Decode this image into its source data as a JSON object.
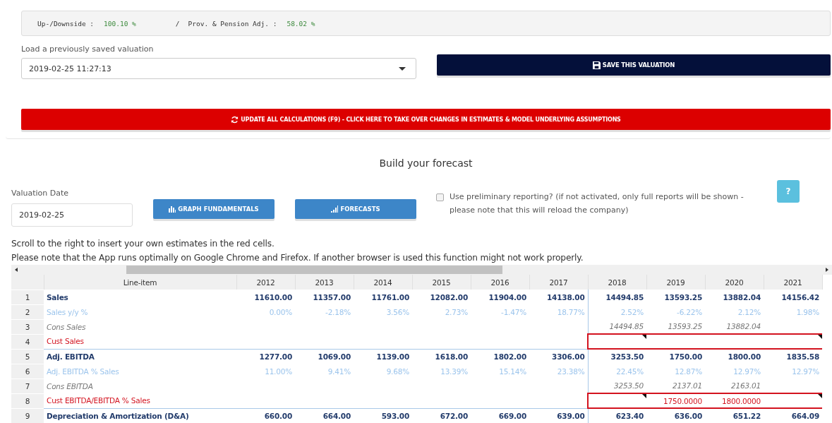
{
  "summary": {
    "items": [
      {
        "label": "Up-/Downside :",
        "value": "100.10 %"
      },
      {
        "label": "Prov. & Pension Adj. :",
        "value": "58.02 %"
      }
    ],
    "separator": "/"
  },
  "load": {
    "label": "Load a previously saved valuation",
    "value": "2019-02-25 11:27:13"
  },
  "save_button": "SAVE THIS VALUATION",
  "update_button": "UPDATE ALL CALCULATIONS (F9) - CLICK HERE TO TAKE OVER CHANGES IN ESTIMATES & MODEL UNDERLYING ASSUMPTIONS",
  "section_title": "Build your forecast",
  "valuation_date": {
    "label": "Valuation Date",
    "value": "2019-02-25"
  },
  "graph_button": "GRAPH FUNDAMENTALS",
  "forecasts_button": "FORECASTS",
  "preliminary": {
    "label": "Use preliminary reporting? (if not activated, only full reports will be shown - please note that this will reload the company)",
    "checked": false
  },
  "help_button": "?",
  "notes": [
    "Scroll to the right to insert your own estimates in the red cells.",
    "Please note that the App runs optimally on Google Chrome and Firefox. If another browser is used this function might not work properly."
  ],
  "table": {
    "columns": [
      {
        "kind": "number"
      },
      {
        "kind": "item",
        "label": "Line-item"
      },
      {
        "kind": "actual",
        "label": "2012"
      },
      {
        "kind": "actual",
        "label": "2013"
      },
      {
        "kind": "actual",
        "label": "2014"
      },
      {
        "kind": "actual",
        "label": "2015"
      },
      {
        "kind": "actual",
        "label": "2016"
      },
      {
        "kind": "actual",
        "label": "2017"
      },
      {
        "kind": "forecast",
        "label": "2018"
      },
      {
        "kind": "forecast",
        "label": "2019"
      },
      {
        "kind": "forecast",
        "label": "2020"
      },
      {
        "kind": "forecast",
        "label": "2021"
      }
    ],
    "rows": [
      {
        "kind": "main",
        "cells": [
          "1",
          "Sales",
          "11610.00",
          "11357.00",
          "11761.00",
          "12082.00",
          "11904.00",
          "14138.00",
          "14494.85",
          "13593.25",
          "13882.04",
          "14156.42"
        ]
      },
      {
        "kind": "pct",
        "cells": [
          "2",
          "Sales y/y %",
          "0.00%",
          "-2.18%",
          "3.56%",
          "2.73%",
          "-1.47%",
          "18.77%",
          "2.52%",
          "-6.22%",
          "2.12%",
          "1.98%"
        ]
      },
      {
        "kind": "cons",
        "cells": [
          "3",
          "Cons Sales",
          "",
          "",
          "",
          "",
          "",
          "",
          "14494.85",
          "13593.25",
          "13882.04",
          ""
        ]
      },
      {
        "kind": "cust",
        "cells": [
          "4",
          "Cust Sales",
          "",
          "",
          "",
          "",
          "",
          "",
          "",
          "",
          "",
          ""
        ]
      },
      {
        "kind": "main",
        "cells": [
          "5",
          "Adj. EBITDA",
          "1277.00",
          "1069.00",
          "1139.00",
          "1618.00",
          "1802.00",
          "3306.00",
          "3253.50",
          "1750.00",
          "1800.00",
          "1835.58"
        ]
      },
      {
        "kind": "pct",
        "cells": [
          "6",
          "Adj. EBITDA % Sales",
          "11.00%",
          "9.41%",
          "9.68%",
          "13.39%",
          "15.14%",
          "23.38%",
          "22.45%",
          "12.87%",
          "12.97%",
          "12.97%"
        ]
      },
      {
        "kind": "cons",
        "cells": [
          "7",
          "Cons EBITDA",
          "",
          "",
          "",
          "",
          "",
          "",
          "3253.50",
          "2137.01",
          "2163.01",
          ""
        ]
      },
      {
        "kind": "cust",
        "cells": [
          "8",
          "Cust EBITDA/EBITDA % Sales",
          "",
          "",
          "",
          "",
          "",
          "",
          "",
          "1750.0000",
          "1800.0000",
          ""
        ]
      },
      {
        "kind": "main",
        "cells": [
          "9",
          "Depreciation & Amortization (D&A)",
          "660.00",
          "664.00",
          "593.00",
          "672.00",
          "669.00",
          "639.00",
          "623.40",
          "636.00",
          "651.22",
          "664.09"
        ]
      }
    ]
  }
}
